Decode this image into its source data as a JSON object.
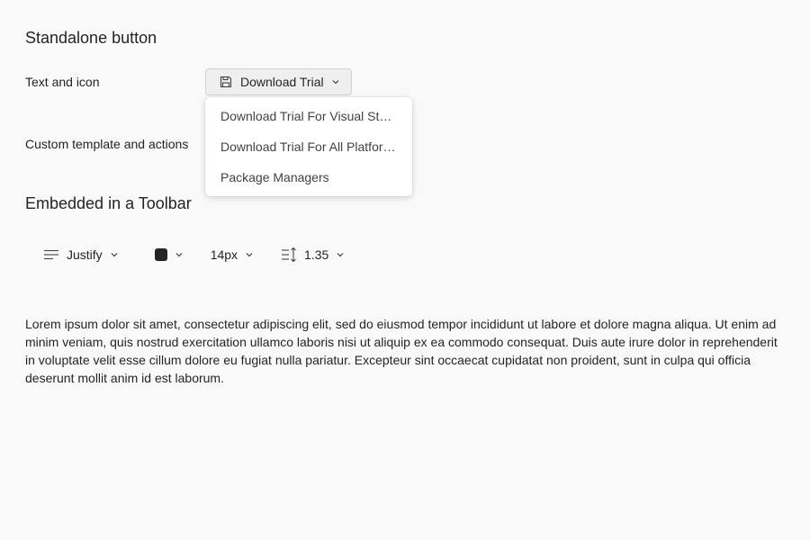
{
  "sections": {
    "standalone_title": "Standalone button",
    "toolbar_title": "Embedded in a Toolbar"
  },
  "rows": {
    "text_and_icon_label": "Text and icon",
    "custom_template_label": "Custom template and actions"
  },
  "download_button": {
    "label": "Download Trial",
    "icon": "save-icon"
  },
  "menu": {
    "items": [
      {
        "label": "Download Trial For Visual St…"
      },
      {
        "label": "Download Trial For All Platfor…"
      },
      {
        "label": "Package Managers"
      }
    ]
  },
  "toolbar": {
    "align": {
      "label": "Justify",
      "icon": "text-justify-icon"
    },
    "color": {
      "swatch": "#242424"
    },
    "font_size": {
      "label": "14px"
    },
    "line_height": {
      "label": "1.35",
      "icon": "line-height-icon"
    }
  },
  "body_text": "Lorem ipsum dolor sit amet, consectetur adipiscing elit, sed do eiusmod tempor incididunt ut labore et dolore magna aliqua. Ut enim ad minim veniam, quis nostrud exercitation ullamco laboris nisi ut aliquip ex ea commodo consequat. Duis aute irure dolor in reprehenderit in voluptate velit esse cillum dolore eu fugiat nulla pariatur. Excepteur sint occaecat cupidatat non proident, sunt in culpa qui officia deserunt mollit anim id est laborum."
}
